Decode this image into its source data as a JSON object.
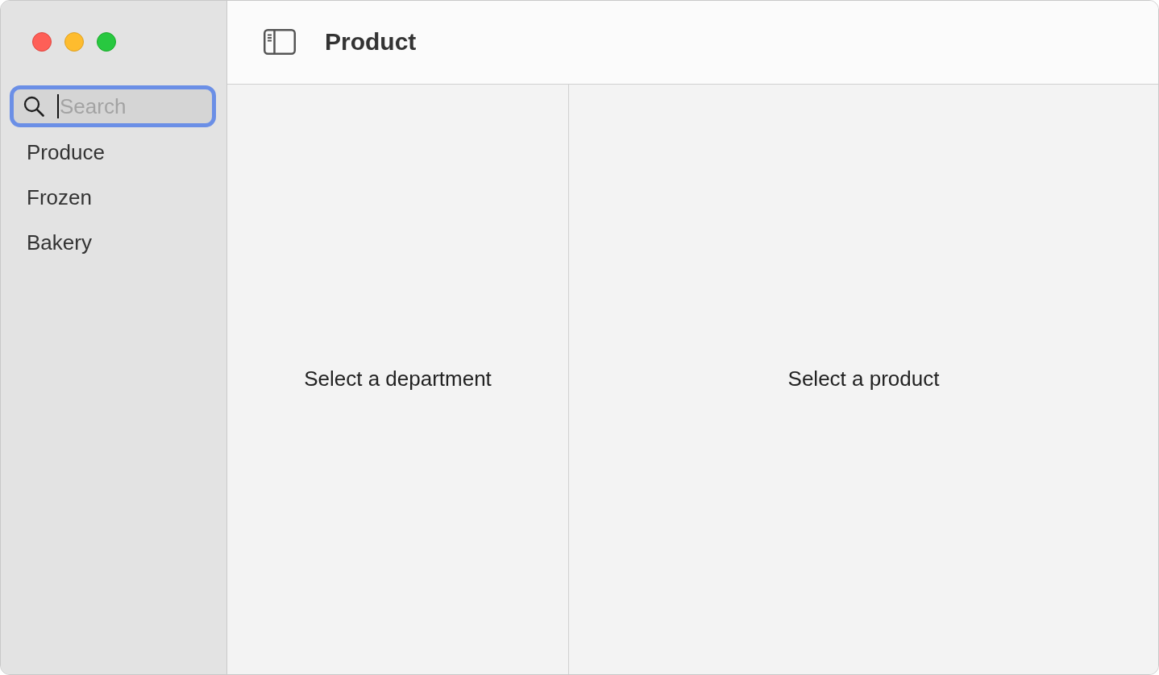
{
  "window": {
    "controls": [
      {
        "kind": "close"
      },
      {
        "kind": "minimize"
      },
      {
        "kind": "zoom"
      }
    ]
  },
  "sidebar": {
    "search": {
      "placeholder": "Search",
      "focused": true
    },
    "items": [
      {
        "label": "Produce",
        "selected": false
      },
      {
        "label": "Frozen",
        "selected": false
      },
      {
        "label": "Bakery",
        "selected": false
      }
    ]
  },
  "toolbar": {
    "title": "Product"
  },
  "panes": [
    {
      "message": "Select a department"
    },
    {
      "message": "Select a product"
    }
  ]
}
